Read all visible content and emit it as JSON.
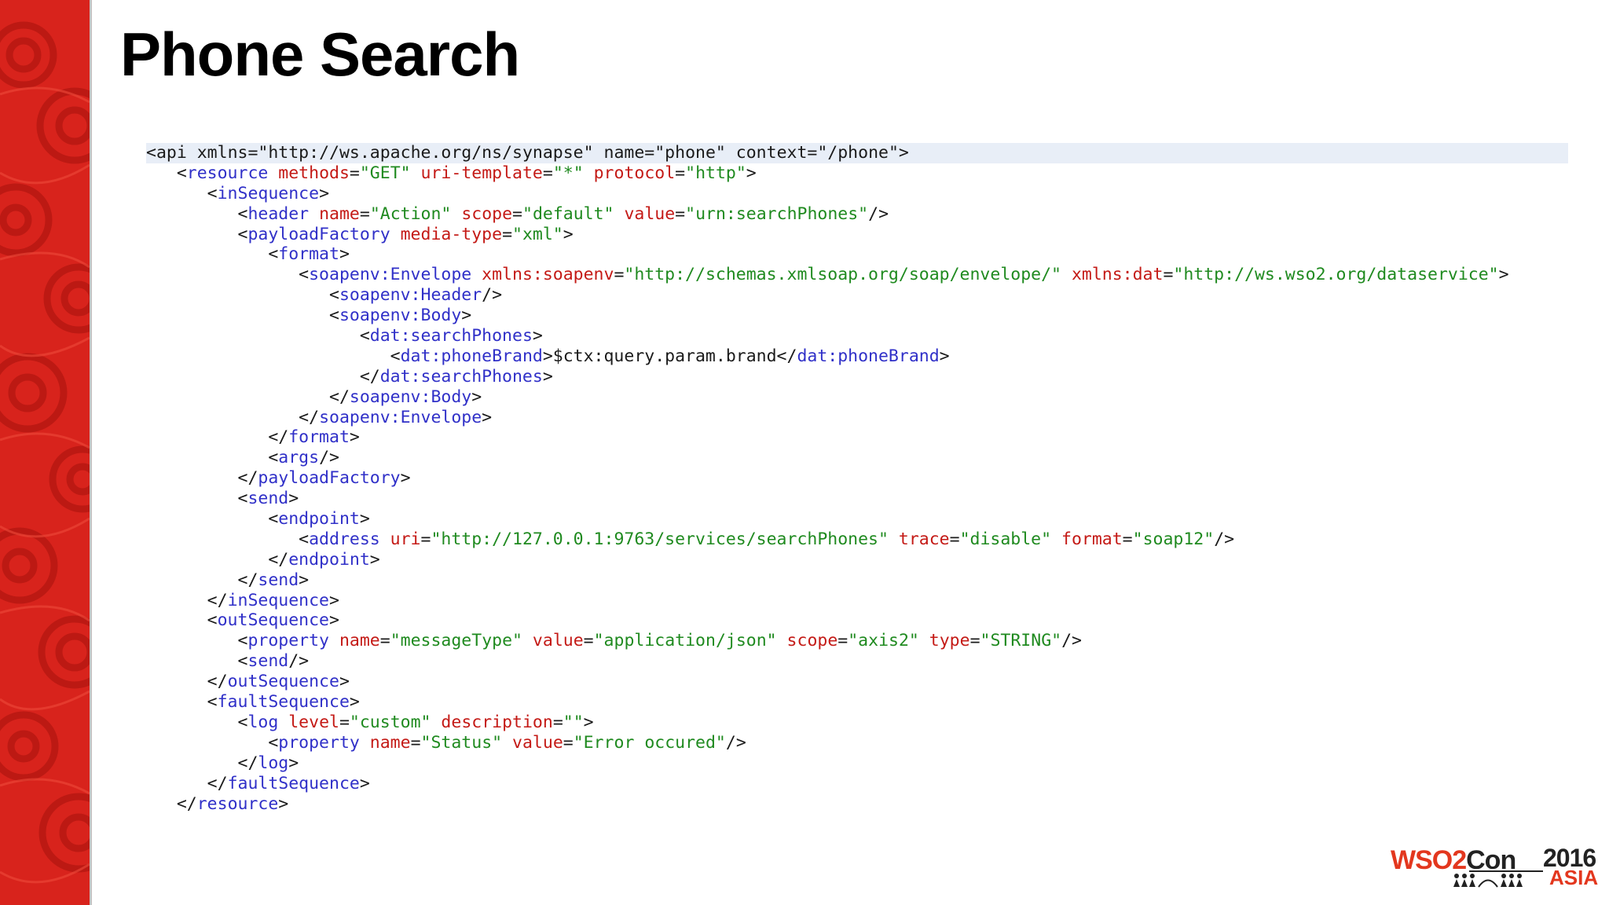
{
  "slide": {
    "title": "Phone Search"
  },
  "code_lines": [
    [
      [
        "x",
        "<"
      ],
      [
        "x",
        "api"
      ],
      [
        "x",
        " xmlns="
      ],
      [
        "x",
        "\"http://ws.apache.org/ns/synapse\""
      ],
      [
        "x",
        " name="
      ],
      [
        "x",
        "\"phone\""
      ],
      [
        "x",
        " context="
      ],
      [
        "x",
        "\"/phone\""
      ],
      [
        "x",
        ">"
      ]
    ],
    [
      [
        "x",
        "   <"
      ],
      [
        "t",
        "resource"
      ],
      [
        "a",
        " methods"
      ],
      [
        "x",
        "="
      ],
      [
        "v",
        "\"GET\""
      ],
      [
        "a",
        " uri-template"
      ],
      [
        "x",
        "="
      ],
      [
        "v",
        "\"*\""
      ],
      [
        "a",
        " protocol"
      ],
      [
        "x",
        "="
      ],
      [
        "v",
        "\"http\""
      ],
      [
        "x",
        ">"
      ]
    ],
    [
      [
        "x",
        "      <"
      ],
      [
        "t",
        "inSequence"
      ],
      [
        "x",
        ">"
      ]
    ],
    [
      [
        "x",
        "         <"
      ],
      [
        "t",
        "header"
      ],
      [
        "a",
        " name"
      ],
      [
        "x",
        "="
      ],
      [
        "v",
        "\"Action\""
      ],
      [
        "a",
        " scope"
      ],
      [
        "x",
        "="
      ],
      [
        "v",
        "\"default\""
      ],
      [
        "a",
        " value"
      ],
      [
        "x",
        "="
      ],
      [
        "v",
        "\"urn:searchPhones\""
      ],
      [
        "x",
        "/>"
      ]
    ],
    [
      [
        "x",
        "         <"
      ],
      [
        "t",
        "payloadFactory"
      ],
      [
        "a",
        " media-type"
      ],
      [
        "x",
        "="
      ],
      [
        "v",
        "\"xml\""
      ],
      [
        "x",
        ">"
      ]
    ],
    [
      [
        "x",
        "            <"
      ],
      [
        "t",
        "format"
      ],
      [
        "x",
        ">"
      ]
    ],
    [
      [
        "x",
        "               <"
      ],
      [
        "t",
        "soapenv:Envelope"
      ],
      [
        "a",
        " xmlns:soapenv"
      ],
      [
        "x",
        "="
      ],
      [
        "v",
        "\"http://schemas.xmlsoap.org/soap/envelope/\""
      ],
      [
        "a",
        " xmlns:dat"
      ],
      [
        "x",
        "="
      ],
      [
        "v",
        "\"http://ws.wso2.org/dataservice\""
      ],
      [
        "x",
        ">"
      ]
    ],
    [
      [
        "x",
        "                  <"
      ],
      [
        "t",
        "soapenv:Header"
      ],
      [
        "x",
        "/>"
      ]
    ],
    [
      [
        "x",
        "                  <"
      ],
      [
        "t",
        "soapenv:Body"
      ],
      [
        "x",
        ">"
      ]
    ],
    [
      [
        "x",
        "                     <"
      ],
      [
        "t",
        "dat:searchPhones"
      ],
      [
        "x",
        ">"
      ]
    ],
    [
      [
        "x",
        "                        <"
      ],
      [
        "t",
        "dat:phoneBrand"
      ],
      [
        "x",
        ">$ctx:query.param.brand</"
      ],
      [
        "t",
        "dat:phoneBrand"
      ],
      [
        "x",
        ">"
      ]
    ],
    [
      [
        "x",
        "                     </"
      ],
      [
        "t",
        "dat:searchPhones"
      ],
      [
        "x",
        ">"
      ]
    ],
    [
      [
        "x",
        "                  </"
      ],
      [
        "t",
        "soapenv:Body"
      ],
      [
        "x",
        ">"
      ]
    ],
    [
      [
        "x",
        "               </"
      ],
      [
        "t",
        "soapenv:Envelope"
      ],
      [
        "x",
        ">"
      ]
    ],
    [
      [
        "x",
        "            </"
      ],
      [
        "t",
        "format"
      ],
      [
        "x",
        ">"
      ]
    ],
    [
      [
        "x",
        "            <"
      ],
      [
        "t",
        "args"
      ],
      [
        "x",
        "/>"
      ]
    ],
    [
      [
        "x",
        "         </"
      ],
      [
        "t",
        "payloadFactory"
      ],
      [
        "x",
        ">"
      ]
    ],
    [
      [
        "x",
        "         <"
      ],
      [
        "t",
        "send"
      ],
      [
        "x",
        ">"
      ]
    ],
    [
      [
        "x",
        "            <"
      ],
      [
        "t",
        "endpoint"
      ],
      [
        "x",
        ">"
      ]
    ],
    [
      [
        "x",
        "               <"
      ],
      [
        "t",
        "address"
      ],
      [
        "a",
        " uri"
      ],
      [
        "x",
        "="
      ],
      [
        "v",
        "\"http://127.0.0.1:9763/services/searchPhones\""
      ],
      [
        "a",
        " trace"
      ],
      [
        "x",
        "="
      ],
      [
        "v",
        "\"disable\""
      ],
      [
        "a",
        " format"
      ],
      [
        "x",
        "="
      ],
      [
        "v",
        "\"soap12\""
      ],
      [
        "x",
        "/>"
      ]
    ],
    [
      [
        "x",
        "            </"
      ],
      [
        "t",
        "endpoint"
      ],
      [
        "x",
        ">"
      ]
    ],
    [
      [
        "x",
        "         </"
      ],
      [
        "t",
        "send"
      ],
      [
        "x",
        ">"
      ]
    ],
    [
      [
        "x",
        "      </"
      ],
      [
        "t",
        "inSequence"
      ],
      [
        "x",
        ">"
      ]
    ],
    [
      [
        "x",
        "      <"
      ],
      [
        "t",
        "outSequence"
      ],
      [
        "x",
        ">"
      ]
    ],
    [
      [
        "x",
        "         <"
      ],
      [
        "t",
        "property"
      ],
      [
        "a",
        " name"
      ],
      [
        "x",
        "="
      ],
      [
        "v",
        "\"messageType\""
      ],
      [
        "a",
        " value"
      ],
      [
        "x",
        "="
      ],
      [
        "v",
        "\"application/json\""
      ],
      [
        "a",
        " scope"
      ],
      [
        "x",
        "="
      ],
      [
        "v",
        "\"axis2\""
      ],
      [
        "a",
        " type"
      ],
      [
        "x",
        "="
      ],
      [
        "v",
        "\"STRING\""
      ],
      [
        "x",
        "/>"
      ]
    ],
    [
      [
        "x",
        "         <"
      ],
      [
        "t",
        "send"
      ],
      [
        "x",
        "/>"
      ]
    ],
    [
      [
        "x",
        "      </"
      ],
      [
        "t",
        "outSequence"
      ],
      [
        "x",
        ">"
      ]
    ],
    [
      [
        "x",
        "      <"
      ],
      [
        "t",
        "faultSequence"
      ],
      [
        "x",
        ">"
      ]
    ],
    [
      [
        "x",
        "         <"
      ],
      [
        "t",
        "log"
      ],
      [
        "a",
        " level"
      ],
      [
        "x",
        "="
      ],
      [
        "v",
        "\"custom\""
      ],
      [
        "a",
        " description"
      ],
      [
        "x",
        "="
      ],
      [
        "v",
        "\"\""
      ],
      [
        "x",
        ">"
      ]
    ],
    [
      [
        "x",
        "            <"
      ],
      [
        "t",
        "property"
      ],
      [
        "a",
        " name"
      ],
      [
        "x",
        "="
      ],
      [
        "v",
        "\"Status\""
      ],
      [
        "a",
        " value"
      ],
      [
        "x",
        "="
      ],
      [
        "v",
        "\"Error occured\""
      ],
      [
        "x",
        "/>"
      ]
    ],
    [
      [
        "x",
        "         </"
      ],
      [
        "t",
        "log"
      ],
      [
        "x",
        ">"
      ]
    ],
    [
      [
        "x",
        "      </"
      ],
      [
        "t",
        "faultSequence"
      ],
      [
        "x",
        ">"
      ]
    ],
    [
      [
        "x",
        "   </"
      ],
      [
        "t",
        "resource"
      ],
      [
        "x",
        ">"
      ]
    ]
  ],
  "logo": {
    "brand_prefix": "WSO2",
    "brand_suffix": "Con",
    "year": "2016",
    "region": "ASIA"
  },
  "colors": {
    "sidebar": "#d8231c",
    "tag": "#3030c8",
    "attribute": "#c41a16",
    "value": "#1f8a1f",
    "line_highlight": "#e8eef7",
    "logo_accent": "#e3371e"
  },
  "icons": {
    "sidebar_pattern": "red-swirl-pattern",
    "logo_people": "people-silhouettes-icon"
  }
}
